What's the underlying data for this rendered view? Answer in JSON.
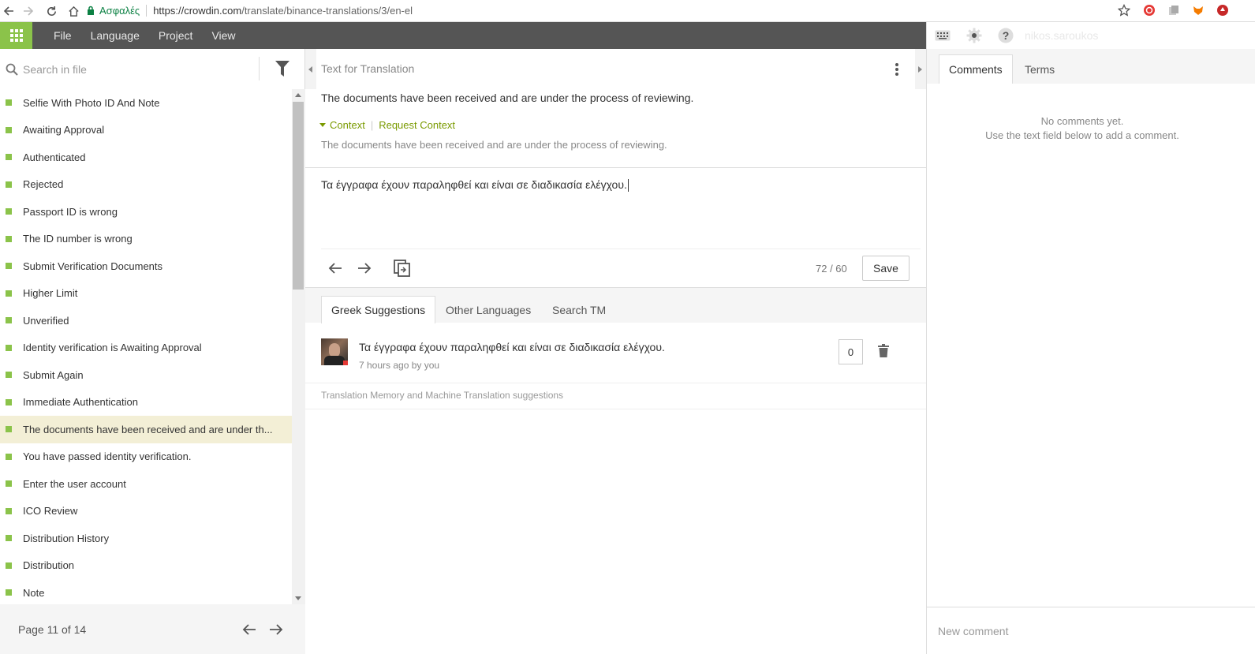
{
  "browser": {
    "secure_label": "Ασφαλές",
    "url_host": "https://crowdin.com",
    "url_path": "/translate/binance-translations/3/en-el"
  },
  "appbar": {
    "menu": [
      "File",
      "Language",
      "Project",
      "View"
    ],
    "username": "nikos.saroukos",
    "accent": "#8bc34a"
  },
  "sidebar": {
    "search_placeholder": "Search in file",
    "items": [
      {
        "label": "Selfie With Photo ID And Note"
      },
      {
        "label": "Awaiting Approval"
      },
      {
        "label": "Authenticated"
      },
      {
        "label": "Rejected"
      },
      {
        "label": "Passport ID is wrong"
      },
      {
        "label": "The ID number is wrong"
      },
      {
        "label": "Submit Verification Documents"
      },
      {
        "label": "Higher Limit"
      },
      {
        "label": "Unverified"
      },
      {
        "label": "Identity verification is Awaiting Approval"
      },
      {
        "label": "Submit Again"
      },
      {
        "label": "Immediate Authentication"
      },
      {
        "label": "The documents have been received and are under th..."
      },
      {
        "label": "You have passed identity verification."
      },
      {
        "label": "Enter the user account"
      },
      {
        "label": "ICO Review"
      },
      {
        "label": "Distribution History"
      },
      {
        "label": "Distribution"
      },
      {
        "label": "Note"
      }
    ],
    "page_label": "Page 11 of 14"
  },
  "editor": {
    "header": "Text for Translation",
    "source_text": "The documents have been received and are under the process of reviewing.",
    "context_label": "Context",
    "request_context_label": "Request Context",
    "context_text": "The documents have been received and are under the process of reviewing.",
    "translation_text": "Τα έγγραφα έχουν παραληφθεί και είναι σε διαδικασία ελέγχου.",
    "char_counter": "72 / 60",
    "save_label": "Save",
    "tabs": [
      "Greek Suggestions",
      "Other Languages",
      "Search TM"
    ],
    "suggestion": {
      "text": "Τα έγγραφα έχουν παραληφθεί και είναι σε διαδικασία ελέγχου.",
      "meta": "7 hours ago by you",
      "votes": "0"
    },
    "tm_label": "Translation Memory and Machine Translation suggestions"
  },
  "comments": {
    "tabs": [
      "Comments",
      "Terms"
    ],
    "empty_line1": "No comments yet.",
    "empty_line2": "Use the text field below to add a comment.",
    "new_placeholder": "New comment"
  }
}
